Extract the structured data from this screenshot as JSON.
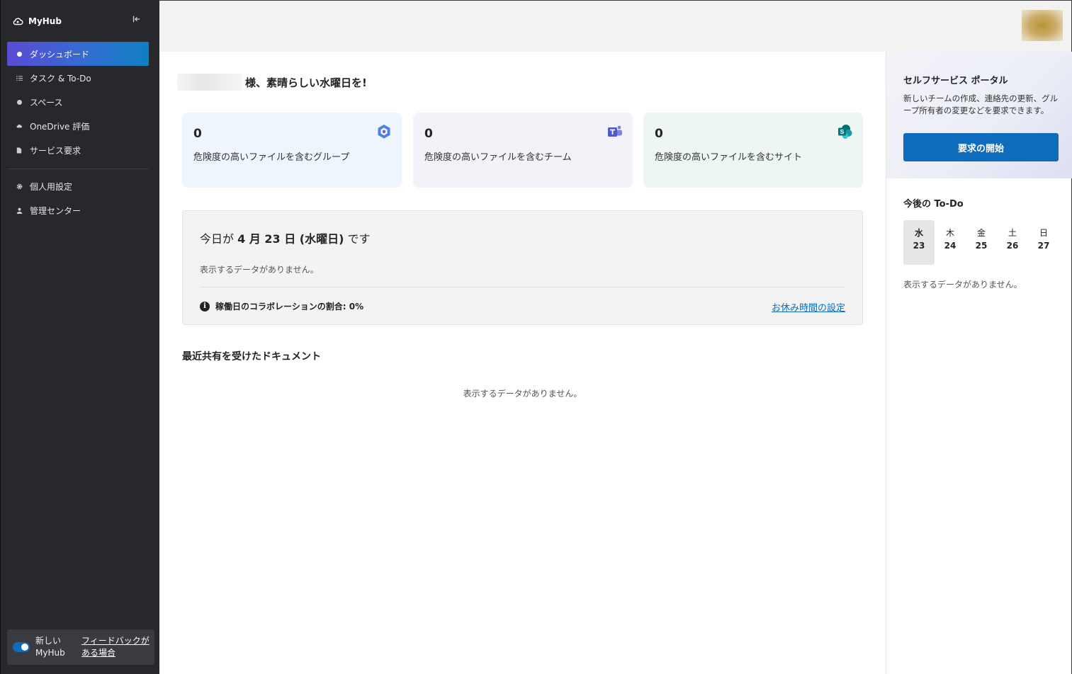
{
  "app": {
    "name": "MyHub"
  },
  "sidebar": {
    "items": [
      {
        "label": "ダッシュボード",
        "icon": "dashboard-icon"
      },
      {
        "label": "タスク & To-Do",
        "icon": "tasks-icon"
      },
      {
        "label": "スペース",
        "icon": "globe-icon"
      },
      {
        "label": "OneDrive 評価",
        "icon": "cloud-icon"
      },
      {
        "label": "サービス要求",
        "icon": "document-icon"
      },
      {
        "label": "個人用設定",
        "icon": "gear-icon"
      },
      {
        "label": "管理センター",
        "icon": "person-icon"
      }
    ],
    "feedback": {
      "toggle_label": "新しい MyHub",
      "link": "フィードバックがある場合"
    }
  },
  "greeting": "様、素晴らしい水曜日を!",
  "cards": [
    {
      "value": "0",
      "label": "危険度の高いファイルを含むグループ",
      "icon": "m365-icon"
    },
    {
      "value": "0",
      "label": "危険度の高いファイルを含むチーム",
      "icon": "teams-icon"
    },
    {
      "value": "0",
      "label": "危険度の高いファイルを含むサイト",
      "icon": "sharepoint-icon"
    }
  ],
  "today": {
    "prefix": "今日が",
    "date": "4 月 23 日 (水曜日)",
    "suffix": "です",
    "empty": "表示するデータがありません。",
    "collab": "稼働日のコラボレーションの割合: 0%",
    "off_link": "お休み時間の設定"
  },
  "docs": {
    "title": "最近共有を受けたドキュメント",
    "empty": "表示するデータがありません。"
  },
  "ssp": {
    "title": "セルフサービス ポータル",
    "desc": "新しいチームの作成、連絡先の更新、グループ所有者の変更などを要求できます。",
    "button": "要求の開始"
  },
  "todo": {
    "title": "今後の To-Do",
    "days": [
      {
        "w": "水",
        "d": "23"
      },
      {
        "w": "木",
        "d": "24"
      },
      {
        "w": "金",
        "d": "25"
      },
      {
        "w": "土",
        "d": "26"
      },
      {
        "w": "日",
        "d": "27"
      }
    ],
    "empty": "表示するデータがありません。"
  },
  "colors": {
    "accent": "#0f6cbd",
    "sidebar_bg": "#27282c",
    "card_blue": "#eef5fd",
    "card_purple": "#f4f2f9",
    "card_green": "#eef6f4"
  }
}
